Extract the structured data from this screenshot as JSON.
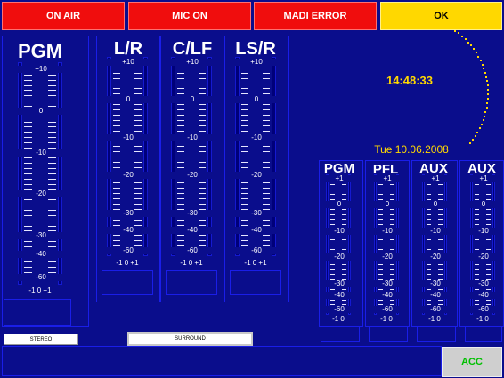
{
  "status_buttons": {
    "on_air": "ON AIR",
    "mic_on": "MIC ON",
    "madi_error": "MADI ERROR",
    "ok": "OK"
  },
  "clock": {
    "time": "14:48:33",
    "date": "Tue 10.06.2008"
  },
  "main_meters": {
    "pgm": {
      "label": "PGM",
      "footer": "-1  0  +1",
      "scale": [
        "+10",
        "0",
        "-10",
        "-20",
        "-30",
        "-40",
        "-60"
      ]
    },
    "lr": {
      "label": "L/R",
      "footer": "-1  0  +1",
      "scale": [
        "+10",
        "0",
        "-10",
        "-20",
        "-30",
        "-40",
        "-60"
      ]
    },
    "clf": {
      "label": "C/LF",
      "footer": "-1  0  +1",
      "scale": [
        "+10",
        "0",
        "-10",
        "-20",
        "-30",
        "-40",
        "-60"
      ]
    },
    "lsr": {
      "label": "LS/R",
      "footer": "-1  0  +1",
      "scale": [
        "+10",
        "0",
        "-10",
        "-20",
        "-30",
        "-40",
        "-60"
      ]
    }
  },
  "small_meters": {
    "pgm": {
      "label": "PGM",
      "footer": "-1  0",
      "scale": [
        "+1",
        "0",
        "-10",
        "-20",
        "-30",
        "-40",
        "-60"
      ]
    },
    "pfl": {
      "label": "PFL",
      "footer": "-1  0",
      "scale": [
        "+1",
        "0",
        "-10",
        "-20",
        "-30",
        "-40",
        "-60"
      ]
    },
    "aux1": {
      "label": "AUX",
      "footer": "-1  0",
      "scale": [
        "+1",
        "0",
        "-10",
        "-20",
        "-30",
        "-40",
        "-60"
      ]
    },
    "aux2": {
      "label": "AUX",
      "footer": "-1  0",
      "scale": [
        "+1",
        "0",
        "-10",
        "-20",
        "-30",
        "-40",
        "-60"
      ]
    }
  },
  "mode_buttons": {
    "stereo": "STEREO",
    "surround": "SURROUND"
  },
  "acc_button": "ACC",
  "colors": {
    "background": "#0a0d8c",
    "alarm_red": "#f00d0d",
    "ok_yellow": "#ffd800",
    "clock_yellow": "#ffd800",
    "acc_green": "#00c000"
  }
}
